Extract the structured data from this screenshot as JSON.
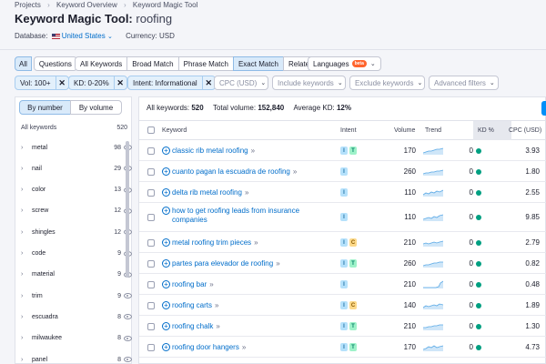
{
  "breadcrumbs": [
    "Projects",
    "Keyword Overview",
    "Keyword Magic Tool"
  ],
  "title": {
    "tool": "Keyword Magic Tool:",
    "keyword": "roofing"
  },
  "database": {
    "label": "Database:",
    "value": "United States",
    "currency": "Currency: USD"
  },
  "tabs1": [
    "All",
    "Questions"
  ],
  "tabs2": [
    "All Keywords",
    "Broad Match",
    "Phrase Match",
    "Exact Match",
    "Related"
  ],
  "languages": {
    "label": "Languages",
    "badge": "beta"
  },
  "filters": [
    {
      "label": "Vol: 100+"
    },
    {
      "label": "KD: 0-20%"
    },
    {
      "label": "Intent: Informational"
    }
  ],
  "dropdowns": [
    "CPC (USD)",
    "Include keywords",
    "Exclude keywords",
    "Advanced filters"
  ],
  "left": {
    "by_number": "By number",
    "by_volume": "By volume",
    "header_label": "All keywords",
    "header_count": "520",
    "groups": [
      {
        "name": "metal",
        "count": "98"
      },
      {
        "name": "nail",
        "count": "29"
      },
      {
        "name": "color",
        "count": "13"
      },
      {
        "name": "screw",
        "count": "12"
      },
      {
        "name": "shingles",
        "count": "12"
      },
      {
        "name": "code",
        "count": "9"
      },
      {
        "name": "material",
        "count": "9"
      },
      {
        "name": "trim",
        "count": "9"
      },
      {
        "name": "escuadra",
        "count": "8"
      },
      {
        "name": "milwaukee",
        "count": "8"
      },
      {
        "name": "panel",
        "count": "8"
      }
    ]
  },
  "summary": {
    "all_label": "All keywords:",
    "all_value": "520",
    "vol_label": "Total volume:",
    "vol_value": "152,840",
    "kd_label": "Average KD:",
    "kd_value": "12%"
  },
  "columns": {
    "keyword": "Keyword",
    "intent": "Intent",
    "volume": "Volume",
    "trend": "Trend",
    "kd": "KD %",
    "cpc": "CPC (USD)"
  },
  "rows": [
    {
      "keyword": "classic rib metal roofing",
      "intent": [
        "I",
        "T"
      ],
      "volume": "170",
      "kd": "0",
      "cpc": "3.93"
    },
    {
      "keyword": "cuanto pagan la escuadra de roofing",
      "intent": [
        "I"
      ],
      "volume": "260",
      "kd": "0",
      "cpc": "1.80"
    },
    {
      "keyword": "delta rib metal roofing",
      "intent": [
        "I"
      ],
      "volume": "110",
      "kd": "0",
      "cpc": "2.55"
    },
    {
      "keyword": "how to get roofing leads from insurance companies",
      "intent": [
        "I"
      ],
      "volume": "110",
      "kd": "0",
      "cpc": "9.85"
    },
    {
      "keyword": "metal roofing trim pieces",
      "intent": [
        "I",
        "C"
      ],
      "volume": "210",
      "kd": "0",
      "cpc": "2.79"
    },
    {
      "keyword": "partes para elevador de roofing",
      "intent": [
        "I",
        "T"
      ],
      "volume": "260",
      "kd": "0",
      "cpc": "0.82"
    },
    {
      "keyword": "roofing bar",
      "intent": [
        "I"
      ],
      "volume": "210",
      "kd": "0",
      "cpc": "0.48"
    },
    {
      "keyword": "roofing carts",
      "intent": [
        "I",
        "C"
      ],
      "volume": "140",
      "kd": "0",
      "cpc": "1.89"
    },
    {
      "keyword": "roofing chalk",
      "intent": [
        "I",
        "T"
      ],
      "volume": "210",
      "kd": "0",
      "cpc": "1.30"
    },
    {
      "keyword": "roofing door hangers",
      "intent": [
        "I",
        "T"
      ],
      "volume": "170",
      "kd": "0",
      "cpc": "4.73"
    }
  ],
  "colors": {
    "link": "#006dca",
    "easy_kd": "#009f81",
    "active_chip": "#d9eafa",
    "brand_orange": "#ff642d"
  }
}
